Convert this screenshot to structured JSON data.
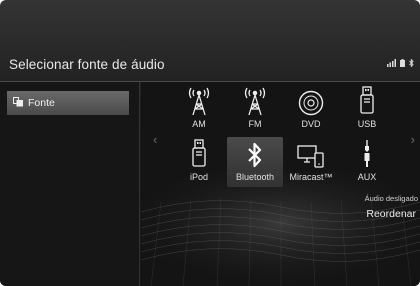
{
  "header": {
    "title": "Selecionar fonte de áudio",
    "status_icons": [
      "signal-icon",
      "battery-icon",
      "bluetooth-status-icon"
    ]
  },
  "sidebar": {
    "items": [
      {
        "label": "Fonte",
        "icon": "source-icon"
      }
    ]
  },
  "sources": [
    {
      "label": "AM",
      "icon": "antenna-icon"
    },
    {
      "label": "FM",
      "icon": "antenna-icon"
    },
    {
      "label": "DVD",
      "icon": "disc-icon"
    },
    {
      "label": "USB",
      "icon": "usb-icon"
    },
    {
      "label": "iPod",
      "icon": "ipod-icon"
    },
    {
      "label": "Bluetooth",
      "icon": "bluetooth-icon",
      "selected": true
    },
    {
      "label": "Miracast™",
      "icon": "miracast-icon"
    },
    {
      "label": "AUX",
      "icon": "aux-icon"
    }
  ],
  "footer": {
    "note": "Áudio desligado",
    "reorder_label": "Reordenar"
  },
  "colors": {
    "background": "#141414",
    "selected_tile": "#6a6a6a",
    "text": "#e8e8e8"
  }
}
